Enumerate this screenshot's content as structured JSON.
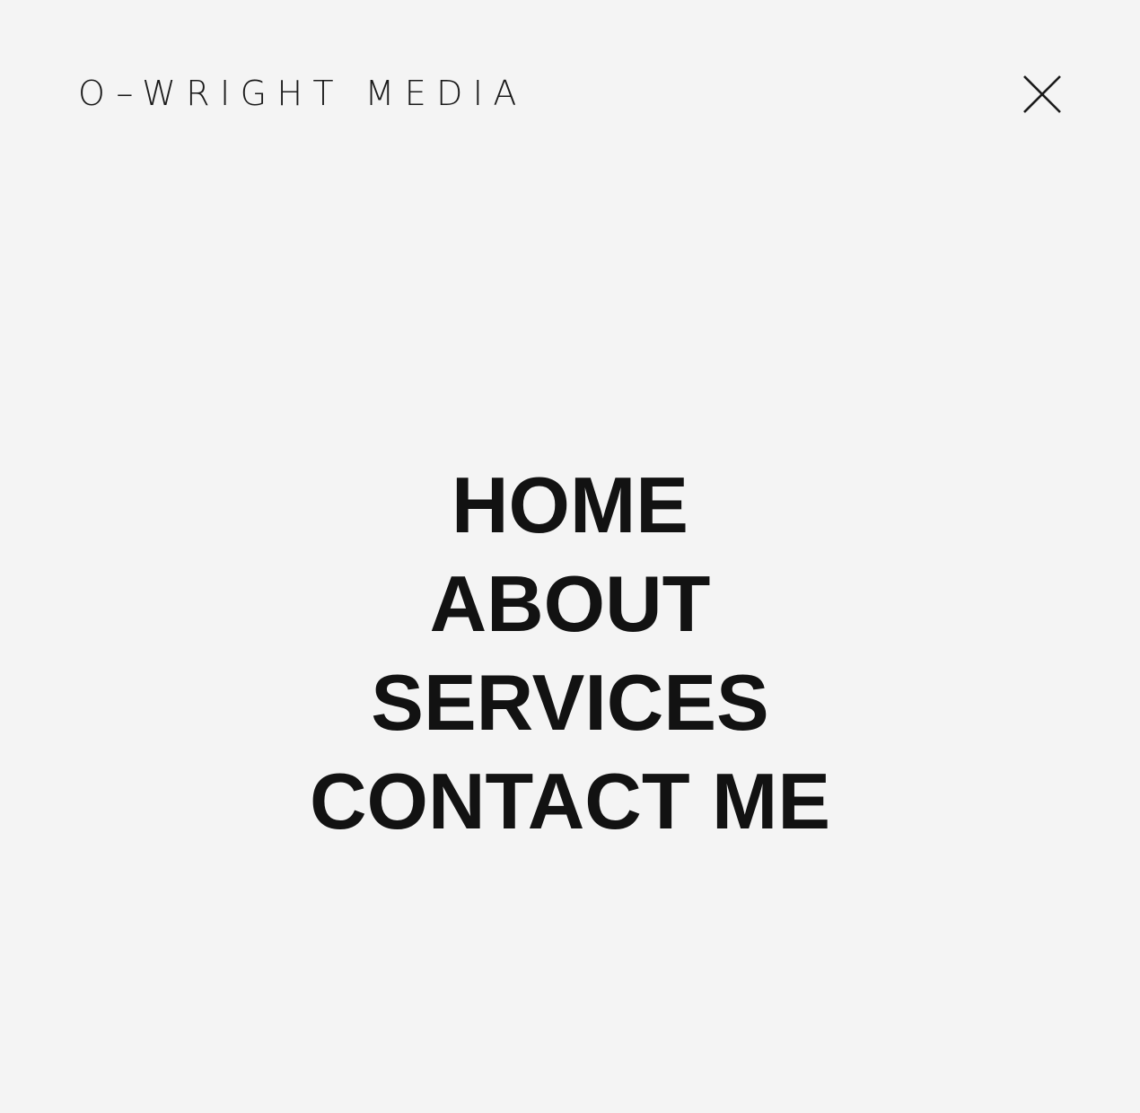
{
  "header": {
    "logo": "O–WRIGHT MEDIA",
    "close_icon": "close-icon"
  },
  "nav": {
    "items": [
      {
        "label": "HOME"
      },
      {
        "label": "ABOUT"
      },
      {
        "label": "SERVICES"
      },
      {
        "label": "CONTACT ME"
      }
    ]
  },
  "colors": {
    "background": "#f4f4f4",
    "text": "#121212"
  }
}
